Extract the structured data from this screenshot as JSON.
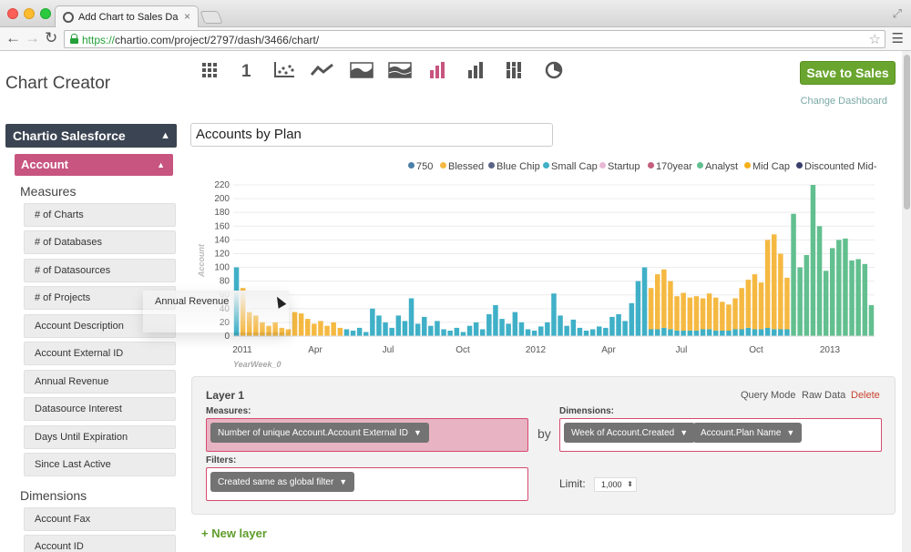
{
  "browser": {
    "tab_title": "Add Chart to Sales Dashboard",
    "tab_close": "×",
    "url_scheme": "https://",
    "url_rest": "chartio.com/project/2797/dash/3466/chart/"
  },
  "app": {
    "title": "Chart Creator",
    "save_label": "Save to Sales",
    "change_dashboard": "Change Dashboard",
    "chart_type_icons": [
      "table-icon",
      "single-value-icon",
      "scatter-icon",
      "line-icon",
      "area-icon",
      "stacked-area-icon",
      "bar-icon",
      "stacked-bar-icon",
      "percent-bar-icon",
      "pie-icon"
    ],
    "active_chart_type": "bar-icon",
    "accent_color": "#c7557f",
    "save_color": "#6aa62f"
  },
  "sidebar": {
    "datasource": "Chartio Salesforce",
    "table": "Account",
    "measures_title": "Measures",
    "measures": [
      "# of Charts",
      "# of Databases",
      "# of Datasources",
      "# of Projects",
      "Account Description",
      "Account External ID",
      "Annual Revenue",
      "Datasource Interest",
      "Days Until Expiration",
      "Since Last Active"
    ],
    "dimensions_title": "Dimensions",
    "dimensions": [
      "Account Fax",
      "Account ID"
    ],
    "dragging": "Annual Revenue"
  },
  "chart_title": "Accounts by Plan",
  "chart_data": {
    "type": "bar",
    "stacked": true,
    "xlabel": "YearWeek_0",
    "ylabel": "Account",
    "ylim": [
      0,
      220
    ],
    "y_ticks": [
      0,
      20,
      40,
      60,
      80,
      100,
      120,
      140,
      160,
      180,
      200,
      220
    ],
    "x_ticks": [
      "2011",
      "Apr",
      "Jul",
      "Oct",
      "2012",
      "Apr",
      "Jul",
      "Oct",
      "2013"
    ],
    "grid": true,
    "legend_position": "top",
    "legend": [
      {
        "name": "750",
        "color": "#4a7fa8"
      },
      {
        "name": "Blessed",
        "color": "#f5b942"
      },
      {
        "name": "Blue Chip",
        "color": "#5a6384"
      },
      {
        "name": "Small Cap",
        "color": "#3fb0c7"
      },
      {
        "name": "Startup",
        "color": "#e9b8d4"
      },
      {
        "name": "170year",
        "color": "#c55f7d"
      },
      {
        "name": "Analyst",
        "color": "#62bf8f"
      },
      {
        "name": "Mid Cap",
        "color": "#f5b11c"
      },
      {
        "name": "Discounted Mid-",
        "color": "#3a3f6a"
      }
    ],
    "series_order": [
      "Small Cap",
      "Mid Cap",
      "Analyst"
    ],
    "bars": [
      {
        "sc": 100,
        "mc": 0,
        "an": 0
      },
      {
        "sc": 0,
        "mc": 70,
        "an": 0
      },
      {
        "sc": 0,
        "mc": 35,
        "an": 0
      },
      {
        "sc": 0,
        "mc": 30,
        "an": 0
      },
      {
        "sc": 0,
        "mc": 20,
        "an": 0
      },
      {
        "sc": 0,
        "mc": 15,
        "an": 0
      },
      {
        "sc": 0,
        "mc": 20,
        "an": 0
      },
      {
        "sc": 0,
        "mc": 12,
        "an": 0
      },
      {
        "sc": 0,
        "mc": 10,
        "an": 0
      },
      {
        "sc": 0,
        "mc": 35,
        "an": 0
      },
      {
        "sc": 0,
        "mc": 33,
        "an": 0
      },
      {
        "sc": 0,
        "mc": 25,
        "an": 0
      },
      {
        "sc": 0,
        "mc": 18,
        "an": 0
      },
      {
        "sc": 0,
        "mc": 22,
        "an": 0
      },
      {
        "sc": 0,
        "mc": 15,
        "an": 0
      },
      {
        "sc": 0,
        "mc": 20,
        "an": 0
      },
      {
        "sc": 0,
        "mc": 12,
        "an": 0
      },
      {
        "sc": 10,
        "mc": 0,
        "an": 0
      },
      {
        "sc": 8,
        "mc": 0,
        "an": 0
      },
      {
        "sc": 12,
        "mc": 0,
        "an": 0
      },
      {
        "sc": 6,
        "mc": 0,
        "an": 0
      },
      {
        "sc": 40,
        "mc": 0,
        "an": 0
      },
      {
        "sc": 30,
        "mc": 0,
        "an": 0
      },
      {
        "sc": 20,
        "mc": 0,
        "an": 0
      },
      {
        "sc": 12,
        "mc": 0,
        "an": 0
      },
      {
        "sc": 30,
        "mc": 0,
        "an": 0
      },
      {
        "sc": 22,
        "mc": 0,
        "an": 0
      },
      {
        "sc": 55,
        "mc": 0,
        "an": 0
      },
      {
        "sc": 18,
        "mc": 0,
        "an": 0
      },
      {
        "sc": 28,
        "mc": 0,
        "an": 0
      },
      {
        "sc": 15,
        "mc": 0,
        "an": 0
      },
      {
        "sc": 22,
        "mc": 0,
        "an": 0
      },
      {
        "sc": 10,
        "mc": 0,
        "an": 0
      },
      {
        "sc": 8,
        "mc": 0,
        "an": 0
      },
      {
        "sc": 12,
        "mc": 0,
        "an": 0
      },
      {
        "sc": 6,
        "mc": 0,
        "an": 0
      },
      {
        "sc": 15,
        "mc": 0,
        "an": 0
      },
      {
        "sc": 20,
        "mc": 0,
        "an": 0
      },
      {
        "sc": 10,
        "mc": 0,
        "an": 0
      },
      {
        "sc": 32,
        "mc": 0,
        "an": 0
      },
      {
        "sc": 45,
        "mc": 0,
        "an": 0
      },
      {
        "sc": 25,
        "mc": 0,
        "an": 0
      },
      {
        "sc": 18,
        "mc": 0,
        "an": 0
      },
      {
        "sc": 35,
        "mc": 0,
        "an": 0
      },
      {
        "sc": 20,
        "mc": 0,
        "an": 0
      },
      {
        "sc": 10,
        "mc": 0,
        "an": 0
      },
      {
        "sc": 8,
        "mc": 0,
        "an": 0
      },
      {
        "sc": 14,
        "mc": 0,
        "an": 0
      },
      {
        "sc": 20,
        "mc": 0,
        "an": 0
      },
      {
        "sc": 62,
        "mc": 0,
        "an": 0
      },
      {
        "sc": 30,
        "mc": 0,
        "an": 0
      },
      {
        "sc": 15,
        "mc": 0,
        "an": 0
      },
      {
        "sc": 24,
        "mc": 0,
        "an": 0
      },
      {
        "sc": 12,
        "mc": 0,
        "an": 0
      },
      {
        "sc": 8,
        "mc": 0,
        "an": 0
      },
      {
        "sc": 10,
        "mc": 0,
        "an": 0
      },
      {
        "sc": 14,
        "mc": 0,
        "an": 0
      },
      {
        "sc": 12,
        "mc": 0,
        "an": 0
      },
      {
        "sc": 28,
        "mc": 0,
        "an": 0
      },
      {
        "sc": 32,
        "mc": 0,
        "an": 0
      },
      {
        "sc": 22,
        "mc": 0,
        "an": 0
      },
      {
        "sc": 48,
        "mc": 0,
        "an": 0
      },
      {
        "sc": 80,
        "mc": 0,
        "an": 0
      },
      {
        "sc": 100,
        "mc": 0,
        "an": 0
      },
      {
        "sc": 10,
        "mc": 60,
        "an": 0
      },
      {
        "sc": 10,
        "mc": 80,
        "an": 0
      },
      {
        "sc": 12,
        "mc": 85,
        "an": 0
      },
      {
        "sc": 10,
        "mc": 70,
        "an": 0
      },
      {
        "sc": 8,
        "mc": 50,
        "an": 0
      },
      {
        "sc": 8,
        "mc": 55,
        "an": 0
      },
      {
        "sc": 8,
        "mc": 48,
        "an": 0
      },
      {
        "sc": 8,
        "mc": 50,
        "an": 0
      },
      {
        "sc": 10,
        "mc": 45,
        "an": 0
      },
      {
        "sc": 10,
        "mc": 52,
        "an": 0
      },
      {
        "sc": 8,
        "mc": 48,
        "an": 0
      },
      {
        "sc": 8,
        "mc": 42,
        "an": 0
      },
      {
        "sc": 8,
        "mc": 38,
        "an": 0
      },
      {
        "sc": 10,
        "mc": 45,
        "an": 0
      },
      {
        "sc": 10,
        "mc": 60,
        "an": 0
      },
      {
        "sc": 12,
        "mc": 70,
        "an": 0
      },
      {
        "sc": 10,
        "mc": 80,
        "an": 0
      },
      {
        "sc": 10,
        "mc": 68,
        "an": 0
      },
      {
        "sc": 12,
        "mc": 128,
        "an": 0
      },
      {
        "sc": 10,
        "mc": 138,
        "an": 0
      },
      {
        "sc": 10,
        "mc": 110,
        "an": 0
      },
      {
        "sc": 10,
        "mc": 75,
        "an": 0
      },
      {
        "sc": 0,
        "mc": 0,
        "an": 178
      },
      {
        "sc": 0,
        "mc": 0,
        "an": 100
      },
      {
        "sc": 0,
        "mc": 0,
        "an": 118
      },
      {
        "sc": 0,
        "mc": 0,
        "an": 220
      },
      {
        "sc": 0,
        "mc": 0,
        "an": 160
      },
      {
        "sc": 0,
        "mc": 0,
        "an": 95
      },
      {
        "sc": 0,
        "mc": 0,
        "an": 128
      },
      {
        "sc": 0,
        "mc": 0,
        "an": 140
      },
      {
        "sc": 0,
        "mc": 0,
        "an": 142
      },
      {
        "sc": 0,
        "mc": 0,
        "an": 110
      },
      {
        "sc": 0,
        "mc": 0,
        "an": 112
      },
      {
        "sc": 0,
        "mc": 0,
        "an": 105
      },
      {
        "sc": 0,
        "mc": 0,
        "an": 45
      }
    ]
  },
  "layer": {
    "title": "Layer 1",
    "query_mode": "Query Mode",
    "raw_data": "Raw Data",
    "delete": "Delete",
    "measures_label": "Measures:",
    "measure_pill": "Number of unique Account.Account External ID",
    "by": "by",
    "dimensions_label": "Dimensions:",
    "dimension_pills": [
      "Week of Account.Created",
      "Account.Plan Name"
    ],
    "filters_label": "Filters:",
    "filter_pill": "Created same as global filter",
    "limit_label": "Limit:",
    "limit_value": "1,000",
    "pill_caret": "▼"
  },
  "new_layer": "+ New layer"
}
